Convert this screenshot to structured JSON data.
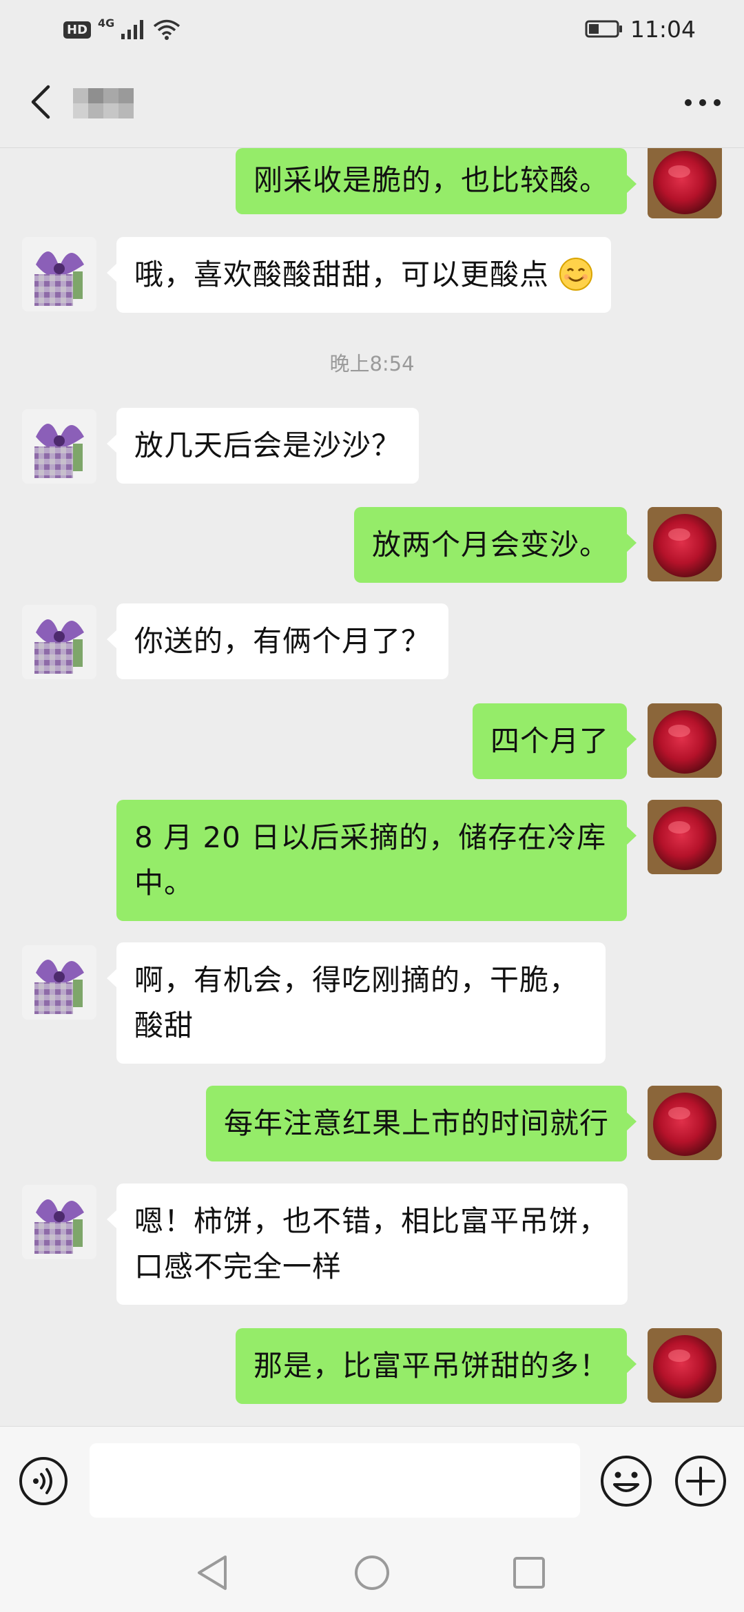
{
  "status_bar": {
    "hd_badge": "HD",
    "network": "4G",
    "time": "11:04"
  },
  "header": {
    "back_icon": "chevron-left-icon",
    "more_icon": "more-dots-icon"
  },
  "chat": {
    "messages": [
      {
        "sender": "me",
        "text": "刚采收是脆的，也比较酸。"
      },
      {
        "sender": "friend",
        "text": "哦，喜欢酸酸甜甜，可以更酸点",
        "emoji": "smile-emoji-icon"
      },
      {
        "sender": "friend",
        "text": "放几天后会是沙沙？"
      },
      {
        "sender": "me",
        "text": "放两个月会变沙。"
      },
      {
        "sender": "friend",
        "text": "你送的，有俩个月了？"
      },
      {
        "sender": "me",
        "text": "四个月了"
      },
      {
        "sender": "me",
        "text": "8 月 20 日以后采摘的，储存在冷库中。"
      },
      {
        "sender": "friend",
        "text": "啊，有机会，得吃刚摘的，干脆，酸甜"
      },
      {
        "sender": "me",
        "text": "每年注意红果上市的时间就行"
      },
      {
        "sender": "friend",
        "text": "嗯！柿饼，也不错，相比富平吊饼，口感不完全一样"
      },
      {
        "sender": "me",
        "text": "那是，比富平吊饼甜的多！"
      }
    ],
    "timestamp": "晚上8:54"
  },
  "input_bar": {
    "voice_icon": "voice-icon",
    "text_value": "",
    "emoji_icon": "emoji-icon",
    "plus_icon": "plus-icon"
  },
  "nav_bar": {
    "back_icon": "nav-back-icon",
    "home_icon": "nav-home-icon",
    "recents_icon": "nav-recents-icon"
  },
  "colors": {
    "background": "#ededed",
    "my_bubble": "#95ec69",
    "friend_bubble": "#ffffff",
    "timestamp_text": "#9a9a9a"
  }
}
